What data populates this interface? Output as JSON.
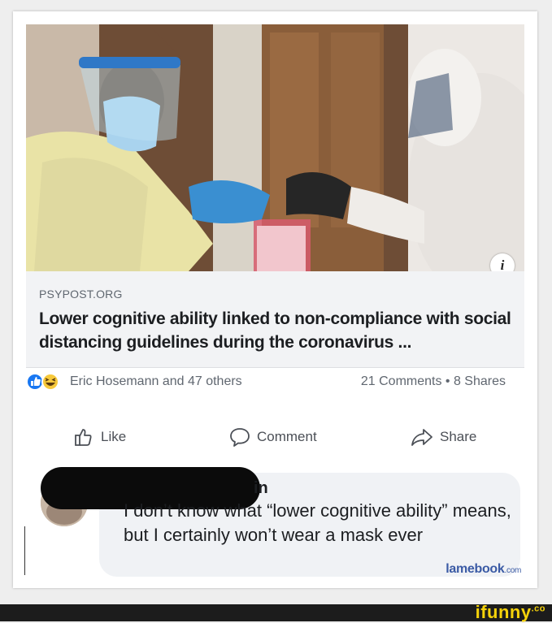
{
  "post": {
    "link_preview": {
      "domain": "PSYPOST.ORG",
      "headline": "Lower cognitive ability linked to non-compliance with social distancing guidelines during the coronavirus ...",
      "info_icon": "info-icon"
    },
    "reactions": {
      "icons": [
        "like-reaction-icon",
        "haha-reaction-icon"
      ],
      "names": "Eric Hosemann and 47 others",
      "counts": "21 Comments • 8 Shares"
    },
    "actions": {
      "like": "Like",
      "comment": "Comment",
      "share": "Share"
    }
  },
  "comment": {
    "author_visible_suffix": "in",
    "text": "I don’t know what “lower cognitive ability” means, but I certainly won’t wear a mask ever"
  },
  "watermarks": {
    "lamebook": "lamebook",
    "lamebook_suffix": ".com",
    "ifunny": "ifunny",
    "ifunny_suffix": ".co"
  },
  "colors": {
    "facebook_blue": "#1877f2",
    "ifunny_yellow": "#f5d20a",
    "preview_bg": "#f2f3f5"
  }
}
